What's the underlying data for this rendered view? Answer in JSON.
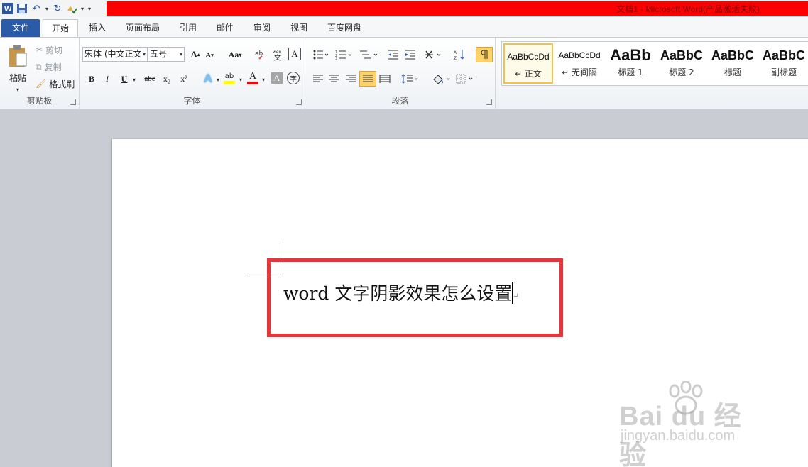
{
  "title": "文档1 - Microsoft Word(产品激活失败)",
  "tabs": [
    "文件",
    "开始",
    "插入",
    "页面布局",
    "引用",
    "邮件",
    "审阅",
    "视图",
    "百度网盘"
  ],
  "clipboard": {
    "paste": "粘贴",
    "cut": "剪切",
    "copy": "复制",
    "format_painter": "格式刷",
    "group": "剪贴板"
  },
  "font": {
    "name": "宋体 (中文正文",
    "size": "五号",
    "change_case": "Aa",
    "group": "字体",
    "bold": "B",
    "italic": "I",
    "underline": "U",
    "strike": "abe",
    "sub": "x₂",
    "sup": "x²"
  },
  "paragraph": {
    "group": "段落"
  },
  "styles": [
    {
      "sample": "AaBbCcDd",
      "name": "↵ 正文"
    },
    {
      "sample": "AaBbCcDd",
      "name": "↵ 无间隔"
    },
    {
      "sample": "AaBb",
      "name": "标题 1"
    },
    {
      "sample": "AaBbC",
      "name": "标题 2"
    },
    {
      "sample": "AaBbC",
      "name": "标题"
    },
    {
      "sample": "AaBbC",
      "name": "副标题"
    }
  ],
  "document": {
    "text": "word 文字阴影效果怎么设置"
  },
  "watermark": {
    "main": "Bai du 经验",
    "sub": "jingyan.baidu.com"
  },
  "colors": {
    "file_tab": "#2a5aa8",
    "title_red": "#ff0000",
    "highlight_box": "#e9353a",
    "font_color_red": "#ff0000",
    "highlight_yellow": "#ffff00"
  }
}
